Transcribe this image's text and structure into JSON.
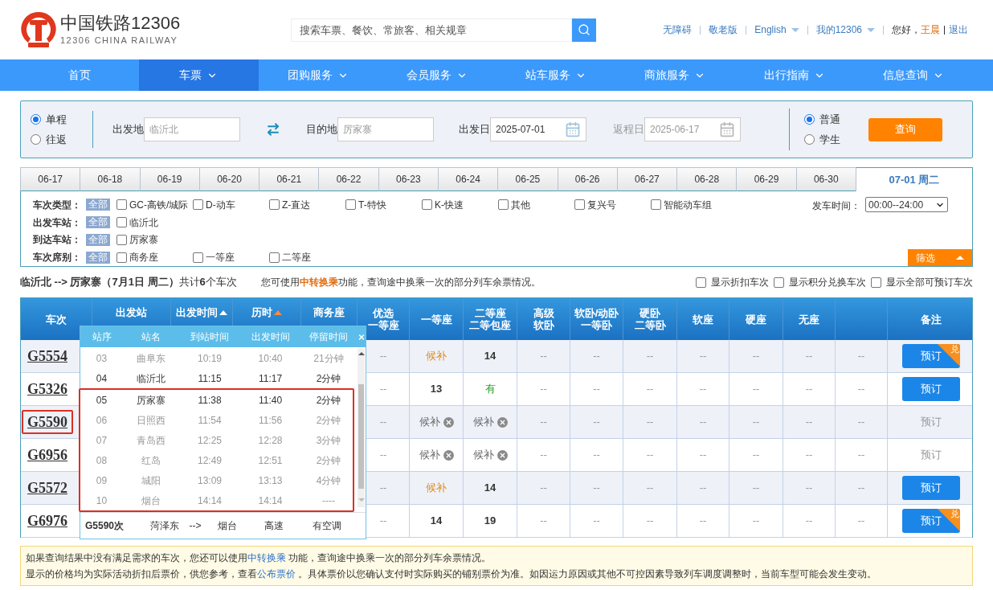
{
  "header": {
    "logo_title": "中国铁路12306",
    "logo_subtitle": "12306 CHINA RAILWAY",
    "search": {
      "placeholder": "搜索车票、餐饮、常旅客、相关规章"
    },
    "links": [
      {
        "label": "无障碍",
        "has_menu": false
      },
      {
        "label": "敬老版",
        "has_menu": false
      },
      {
        "label": "English",
        "has_menu": true
      },
      {
        "label": "我的12306",
        "has_menu": true
      }
    ],
    "greeting": "您好，",
    "user": "王晨",
    "logout": "退出"
  },
  "nav": [
    {
      "label": "首页",
      "selected": false,
      "has_menu": false
    },
    {
      "label": "车票",
      "selected": true,
      "has_menu": true
    },
    {
      "label": "团购服务",
      "selected": false,
      "has_menu": true
    },
    {
      "label": "会员服务",
      "selected": false,
      "has_menu": true
    },
    {
      "label": "站车服务",
      "selected": false,
      "has_menu": true
    },
    {
      "label": "商旅服务",
      "selected": false,
      "has_menu": true
    },
    {
      "label": "出行指南",
      "selected": false,
      "has_menu": true
    },
    {
      "label": "信息查询",
      "selected": false,
      "has_menu": true
    }
  ],
  "search_form": {
    "trip_types": [
      {
        "label": "单程",
        "selected": true
      },
      {
        "label": "往返",
        "selected": false
      }
    ],
    "from": {
      "label": "出发地",
      "value": "临沂北"
    },
    "to": {
      "label": "目的地",
      "value": "厉家寨"
    },
    "dates": [
      {
        "label": "出发日",
        "value": "2025-07-01",
        "disabled": false
      },
      {
        "label": "返程日",
        "value": "2025-06-17",
        "disabled": true
      }
    ],
    "passenger_types": [
      {
        "label": "普通",
        "selected": true
      },
      {
        "label": "学生",
        "selected": false
      }
    ],
    "submit": "查询"
  },
  "date_tabs": [
    {
      "label": "06-17",
      "selected": false
    },
    {
      "label": "06-18",
      "selected": false
    },
    {
      "label": "06-19",
      "selected": false
    },
    {
      "label": "06-20",
      "selected": false
    },
    {
      "label": "06-21",
      "selected": false
    },
    {
      "label": "06-22",
      "selected": false
    },
    {
      "label": "06-23",
      "selected": false
    },
    {
      "label": "06-24",
      "selected": false
    },
    {
      "label": "06-25",
      "selected": false
    },
    {
      "label": "06-26",
      "selected": false
    },
    {
      "label": "06-27",
      "selected": false
    },
    {
      "label": "06-28",
      "selected": false
    },
    {
      "label": "06-29",
      "selected": false
    },
    {
      "label": "06-30",
      "selected": false
    },
    {
      "label": "07-01 周二",
      "selected": true
    }
  ],
  "filters": {
    "rows": [
      {
        "label": "车次类型：",
        "all": "全部",
        "options": [
          {
            "label": "GC-高铁/城际",
            "checked": false
          },
          {
            "label": "D-动车",
            "checked": false
          },
          {
            "label": "Z-直达",
            "checked": false
          },
          {
            "label": "T-特快",
            "checked": false
          },
          {
            "label": "K-快速",
            "checked": false
          },
          {
            "label": "其他",
            "checked": false
          },
          {
            "label": "复兴号",
            "checked": false
          },
          {
            "label": "智能动车组",
            "checked": false
          }
        ]
      },
      {
        "label": "出发车站：",
        "all": "全部",
        "options": [
          {
            "label": "临沂北",
            "checked": false
          }
        ]
      },
      {
        "label": "到达车站：",
        "all": "全部",
        "options": [
          {
            "label": "厉家寨",
            "checked": false
          }
        ]
      },
      {
        "label": "车次席别：",
        "all": "全部",
        "options": [
          {
            "label": "商务座",
            "checked": false
          },
          {
            "label": "一等座",
            "checked": false
          },
          {
            "label": "二等座",
            "checked": false
          }
        ]
      }
    ],
    "time": {
      "label": "发车时间：",
      "value": "00:00--24:00"
    },
    "toggle": "筛选"
  },
  "summary": {
    "route": "**临沂北 --> 厉家寨（7月1日  周二）**共计**6**个车次",
    "hint_before": "您可使用",
    "hint_link": "中转换乘",
    "hint_after": "功能，查询途中换乘一次的部分列车余票情况。",
    "options": [
      {
        "label": "显示折扣车次",
        "checked": false
      },
      {
        "label": "显示积分兑换车次",
        "checked": false
      },
      {
        "label": "显示全部可预订车次",
        "checked": false
      }
    ]
  },
  "table": {
    "columns": [
      {
        "kind": "full",
        "lines": [
          "车次"
        ]
      },
      {
        "kind": "cut",
        "lines": [
          "出发站"
        ]
      },
      {
        "kind": "cut",
        "lines": [
          "出发时间"
        ],
        "sort_active": false
      },
      {
        "kind": "cut",
        "lines": [
          "历时"
        ],
        "sort_active": true
      },
      {
        "kind": "cut",
        "lines": [
          "商务座"
        ]
      },
      {
        "kind": "full",
        "lines": [
          "优选",
          "一等座"
        ]
      },
      {
        "kind": "full",
        "lines": [
          "一等座"
        ]
      },
      {
        "kind": "full",
        "lines": [
          "二等座",
          "二等包座"
        ]
      },
      {
        "kind": "full",
        "lines": [
          "高级",
          "软卧"
        ]
      },
      {
        "kind": "full",
        "lines": [
          "软卧/动卧",
          "一等卧"
        ]
      },
      {
        "kind": "full",
        "lines": [
          "硬卧",
          "二等卧"
        ]
      },
      {
        "kind": "full",
        "lines": [
          "软座"
        ]
      },
      {
        "kind": "full",
        "lines": [
          "硬座"
        ]
      },
      {
        "kind": "full",
        "lines": [
          "无座"
        ]
      },
      {
        "kind": "blank"
      },
      {
        "kind": "full",
        "lines": [
          "备注"
        ]
      }
    ],
    "rows": [
      {
        "train": "G5554",
        "marked": false,
        "seats": [
          {
            "text": "--",
            "kind": "none"
          },
          {
            "text": "候补",
            "kind": "waitlist"
          },
          {
            "text": "14",
            "kind": "count"
          },
          {
            "text": "--",
            "kind": "none"
          },
          {
            "text": "--",
            "kind": "none"
          },
          {
            "text": "--",
            "kind": "none"
          },
          {
            "text": "--",
            "kind": "none"
          },
          {
            "text": "--",
            "kind": "none"
          },
          {
            "text": "--",
            "kind": "none"
          },
          {
            "text": "--",
            "kind": "none"
          }
        ],
        "book": {
          "label": "预订",
          "enabled": true,
          "badge": "兑"
        }
      },
      {
        "train": "G5326",
        "marked": false,
        "seats": [
          {
            "text": "--",
            "kind": "none"
          },
          {
            "text": "13",
            "kind": "count"
          },
          {
            "text": "有",
            "kind": "available"
          },
          {
            "text": "--",
            "kind": "none"
          },
          {
            "text": "--",
            "kind": "none"
          },
          {
            "text": "--",
            "kind": "none"
          },
          {
            "text": "--",
            "kind": "none"
          },
          {
            "text": "--",
            "kind": "none"
          },
          {
            "text": "--",
            "kind": "none"
          },
          {
            "text": "--",
            "kind": "none"
          }
        ],
        "book": {
          "label": "预订",
          "enabled": true
        }
      },
      {
        "train": "G5590",
        "marked": true,
        "seats": [
          {
            "text": "--",
            "kind": "none"
          },
          {
            "text": "候补",
            "kind": "closed"
          },
          {
            "text": "候补",
            "kind": "closed"
          },
          {
            "text": "--",
            "kind": "none"
          },
          {
            "text": "--",
            "kind": "none"
          },
          {
            "text": "--",
            "kind": "none"
          },
          {
            "text": "--",
            "kind": "none"
          },
          {
            "text": "--",
            "kind": "none"
          },
          {
            "text": "--",
            "kind": "none"
          },
          {
            "text": "--",
            "kind": "none"
          }
        ],
        "book": {
          "label": "预订",
          "enabled": false
        }
      },
      {
        "train": "G6956",
        "marked": false,
        "seats": [
          {
            "text": "--",
            "kind": "none"
          },
          {
            "text": "候补",
            "kind": "closed"
          },
          {
            "text": "候补",
            "kind": "closed"
          },
          {
            "text": "--",
            "kind": "none"
          },
          {
            "text": "--",
            "kind": "none"
          },
          {
            "text": "--",
            "kind": "none"
          },
          {
            "text": "--",
            "kind": "none"
          },
          {
            "text": "--",
            "kind": "none"
          },
          {
            "text": "--",
            "kind": "none"
          },
          {
            "text": "--",
            "kind": "none"
          }
        ],
        "book": {
          "label": "预订",
          "enabled": false
        }
      },
      {
        "train": "G5572",
        "marked": false,
        "seats": [
          {
            "text": "--",
            "kind": "none"
          },
          {
            "text": "候补",
            "kind": "waitlist"
          },
          {
            "text": "14",
            "kind": "count"
          },
          {
            "text": "--",
            "kind": "none"
          },
          {
            "text": "--",
            "kind": "none"
          },
          {
            "text": "--",
            "kind": "none"
          },
          {
            "text": "--",
            "kind": "none"
          },
          {
            "text": "--",
            "kind": "none"
          },
          {
            "text": "--",
            "kind": "none"
          },
          {
            "text": "--",
            "kind": "none"
          }
        ],
        "book": {
          "label": "预订",
          "enabled": true
        }
      },
      {
        "train": "G6976",
        "marked": false,
        "seats": [
          {
            "text": "--",
            "kind": "none"
          },
          {
            "text": "14",
            "kind": "count"
          },
          {
            "text": "19",
            "kind": "count"
          },
          {
            "text": "--",
            "kind": "none"
          },
          {
            "text": "--",
            "kind": "none"
          },
          {
            "text": "--",
            "kind": "none"
          },
          {
            "text": "--",
            "kind": "none"
          },
          {
            "text": "--",
            "kind": "none"
          },
          {
            "text": "--",
            "kind": "none"
          },
          {
            "text": "--",
            "kind": "none"
          }
        ],
        "book": {
          "label": "预订",
          "enabled": true,
          "badge": "兑"
        }
      }
    ]
  },
  "stops_popup": {
    "columns": [
      "站序",
      "站名",
      "到站时间",
      "出发时间",
      "停留时间"
    ],
    "stops": [
      {
        "no": "03",
        "name": "曲阜东",
        "arrive": "10:19",
        "depart": "10:40",
        "stay": "21分钟",
        "on_route": false,
        "marked": false
      },
      {
        "no": "04",
        "name": "临沂北",
        "arrive": "11:15",
        "depart": "11:17",
        "stay": "2分钟",
        "on_route": true,
        "marked": false
      },
      {
        "no": "05",
        "name": "厉家寨",
        "arrive": "11:38",
        "depart": "11:40",
        "stay": "2分钟",
        "on_route": true,
        "marked": true
      },
      {
        "no": "06",
        "name": "日照西",
        "arrive": "11:54",
        "depart": "11:56",
        "stay": "2分钟",
        "on_route": false,
        "marked": true
      },
      {
        "no": "07",
        "name": "青岛西",
        "arrive": "12:25",
        "depart": "12:28",
        "stay": "3分钟",
        "on_route": false,
        "marked": true
      },
      {
        "no": "08",
        "name": "红岛",
        "arrive": "12:49",
        "depart": "12:51",
        "stay": "2分钟",
        "on_route": false,
        "marked": true
      },
      {
        "no": "09",
        "name": "城阳",
        "arrive": "13:09",
        "depart": "13:13",
        "stay": "4分钟",
        "on_route": false,
        "marked": true
      },
      {
        "no": "10",
        "name": "烟台",
        "arrive": "14:14",
        "depart": "14:14",
        "stay": "----",
        "on_route": false,
        "marked": true
      }
    ],
    "footer": {
      "train": "G5590次",
      "from": "菏泽东",
      "arrow": "-->",
      "to": "烟台",
      "type": "高速",
      "ac": "有空调"
    }
  },
  "notice": [
    {
      "before": "如果查询结果中没有满足需求的车次，您还可以使用",
      "link": "中转换乘",
      "after": " 功能，查询途中换乘一次的部分列车余票情况。"
    },
    {
      "before": "显示的价格均为实际活动折扣后票价，供您参考，查看",
      "link": "公布票价",
      "after": " 。具体票价以您确认支付时实际购买的铺别票价为准。如因运力原因或其他不可控因素导致列车调度调整时，当前车型可能会发生变动。"
    }
  ]
}
